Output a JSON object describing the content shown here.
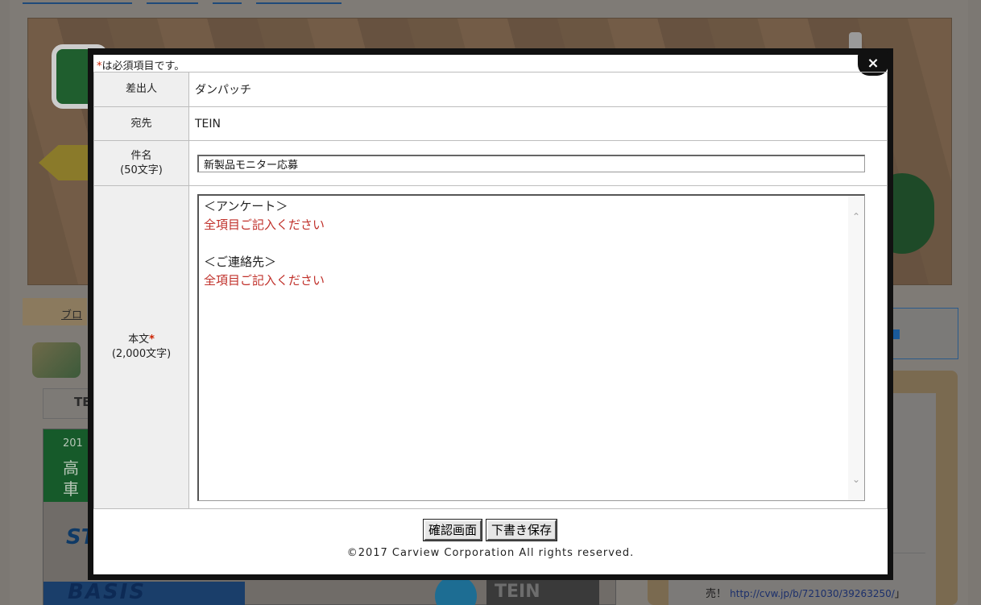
{
  "background": {
    "tab_label": "ブロ",
    "te_label": "TE",
    "ad_lines": [
      "201",
      "高",
      "車"
    ],
    "ad_street_text": "STREET",
    "ad_basis_text": "BASIS",
    "ad_brand_text": "TEIN",
    "right_link_prefix": "売！",
    "right_link_url": "http://cvw.jp/b/721030/39263250/",
    "right_link_suffix": "」"
  },
  "modal": {
    "required_note_star": "*",
    "required_note_text": "は必須項目です。",
    "close_icon": "×",
    "fields": {
      "sender_label": "差出人",
      "sender_value": "ダンパッチ",
      "to_label": "宛先",
      "to_value": "TEIN",
      "subject_label_line1": "件名",
      "subject_label_line2": "(50文字)",
      "subject_value": "新製品モニター応募",
      "body_label": "本文",
      "body_label_star": "*",
      "body_label_line2": "(2,000文字)",
      "body_lines": [
        {
          "text": "＜アンケート＞",
          "color": "black"
        },
        {
          "text": "全項目ご記入ください",
          "color": "red"
        },
        {
          "text": "",
          "color": "black"
        },
        {
          "text": "＜ご連絡先＞",
          "color": "black"
        },
        {
          "text": "全項目ご記入ください",
          "color": "red"
        }
      ]
    },
    "buttons": {
      "confirm_label": "確認画面",
      "draft_label": "下書き保存"
    },
    "copyright": "©2017 Carview Corporation All rights reserved."
  },
  "colors": {
    "required_star": "#cc2200",
    "body_red_text": "#c0302a",
    "label_bg": "#efefef"
  }
}
